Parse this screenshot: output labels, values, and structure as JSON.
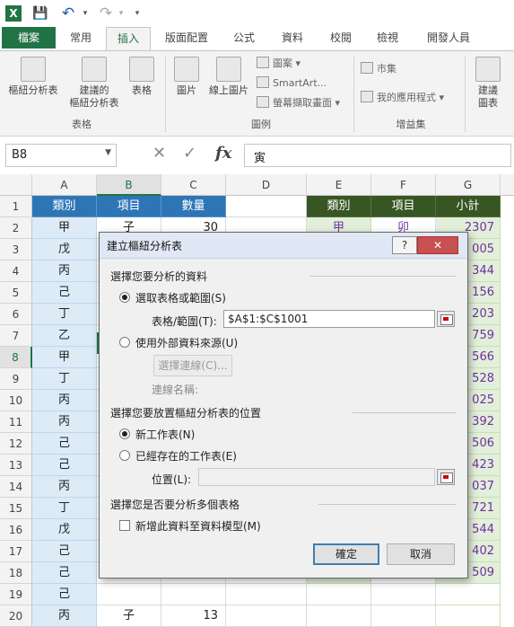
{
  "qat": {
    "excel_logo": "X",
    "save": "💾",
    "undo": "↶",
    "redo": "↷",
    "more": "▾"
  },
  "tabs": [
    "檔案",
    "常用",
    "插入",
    "版面配置",
    "公式",
    "資料",
    "校閱",
    "檢視",
    "開發人員"
  ],
  "active_tab": "插入",
  "ribbon": {
    "pivot_table": "樞紐分析表",
    "recommended_pivot_1": "建議的",
    "recommended_pivot_2": "樞紐分析表",
    "table": "表格",
    "group_tables": "表格",
    "pictures": "圖片",
    "online_pictures": "線上圖片",
    "shapes": "圖案",
    "smartart": "SmartArt...",
    "screenshot": "螢幕擷取畫面",
    "group_illustrations": "圖例",
    "store": "市集",
    "my_apps": "我的應用程式",
    "group_addins": "增益集",
    "recommended_charts_1": "建議",
    "recommended_charts_2": "圖表"
  },
  "formula_bar": {
    "name_box": "B8",
    "cancel": "✕",
    "enter": "✓",
    "fx": "fx",
    "content": "寅"
  },
  "columns": [
    "A",
    "B",
    "C",
    "D",
    "E",
    "F",
    "G"
  ],
  "rows": [
    "1",
    "2",
    "3",
    "4",
    "5",
    "6",
    "7",
    "8",
    "9",
    "10",
    "11",
    "12",
    "13",
    "14",
    "15",
    "16",
    "17",
    "18",
    "19",
    "20"
  ],
  "sheet": {
    "header_left": [
      "類別",
      "項目",
      "數量"
    ],
    "header_right": [
      "類別",
      "項目",
      "小計"
    ],
    "col_a": [
      "甲",
      "戊",
      "丙",
      "己",
      "丁",
      "乙",
      "甲",
      "丁",
      "丙",
      "丙",
      "己",
      "己",
      "丙",
      "丁",
      "戊",
      "己",
      "己",
      "己",
      "丙"
    ],
    "row2_b": "子",
    "row2_c": "30",
    "row20_b": "子",
    "row20_c": "13",
    "row2_e": "甲",
    "row2_f": "卯",
    "row2_g": "2307",
    "col_g_partial": [
      "005",
      "344",
      "156",
      "203",
      "759",
      "566",
      "528",
      "025",
      "392",
      "506",
      "423",
      "037",
      "721",
      "544",
      "402",
      "509"
    ]
  },
  "dialog": {
    "title": "建立樞紐分析表",
    "help": "?",
    "close": "✕",
    "section1": "選擇您要分析的資料",
    "opt_range": "選取表格或範圍(S)",
    "range_label": "表格/範圍(T):",
    "range_value": "$A$1:$C$1001",
    "opt_external": "使用外部資料來源(U)",
    "choose_conn": "選擇連線(C)...",
    "conn_name": "連線名稱:",
    "section2": "選擇您要放置樞紐分析表的位置",
    "opt_new": "新工作表(N)",
    "opt_existing": "已經存在的工作表(E)",
    "location_label": "位置(L):",
    "section3": "選擇您是否要分析多個表格",
    "add_model": "新增此資料至資料模型(M)",
    "ok": "確定",
    "cancel": "取消"
  }
}
